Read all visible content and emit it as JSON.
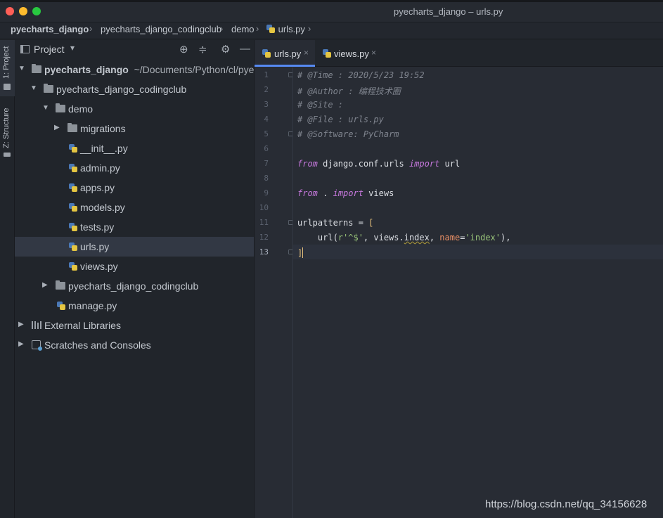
{
  "window": {
    "title": "pyecharts_django – urls.py",
    "controls": [
      "close",
      "minimize",
      "maximize"
    ]
  },
  "breadcrumb": [
    {
      "label": "pyecharts_django",
      "bold": true
    },
    {
      "label": "pyecharts_django_codingclub"
    },
    {
      "label": "demo"
    },
    {
      "label": "urls.py",
      "icon": "python-file-icon"
    }
  ],
  "side_strip": {
    "project_tab": "1: Project",
    "structure_tab": "Z: Structure"
  },
  "project_panel": {
    "title": "Project",
    "tree": [
      {
        "label": "pyecharts_django",
        "hint": "~/Documents/Python/cl/pyecharts_django",
        "type": "folder",
        "expanded": true,
        "bold": true
      },
      {
        "label": "pyecharts_django_codingclub",
        "type": "folder",
        "expanded": true
      },
      {
        "label": "demo",
        "type": "folder",
        "expanded": true
      },
      {
        "label": "migrations",
        "type": "folder",
        "expanded": false
      },
      {
        "label": "__init__.py",
        "type": "python"
      },
      {
        "label": "admin.py",
        "type": "python"
      },
      {
        "label": "apps.py",
        "type": "python"
      },
      {
        "label": "models.py",
        "type": "python"
      },
      {
        "label": "tests.py",
        "type": "python"
      },
      {
        "label": "urls.py",
        "type": "python",
        "selected": true
      },
      {
        "label": "views.py",
        "type": "python"
      },
      {
        "label": "pyecharts_django_codingclub",
        "type": "folder",
        "expanded": false
      },
      {
        "label": "manage.py",
        "type": "python"
      },
      {
        "label": "External Libraries",
        "type": "library",
        "expanded": false
      },
      {
        "label": "Scratches and Consoles",
        "type": "scratch",
        "expanded": false
      }
    ]
  },
  "editor": {
    "tabs": [
      {
        "label": "urls.py",
        "active": true,
        "close": "×"
      },
      {
        "label": "views.py",
        "active": false,
        "close": "×"
      }
    ],
    "line_numbers": [
      "1",
      "2",
      "3",
      "4",
      "5",
      "6",
      "7",
      "8",
      "9",
      "10",
      "11",
      "12",
      "13"
    ],
    "current_line": "13",
    "code": {
      "l1": "# @Time : 2020/5/23 19:52",
      "l2": "# @Author : 编程技术圈",
      "l3": "# @Site :",
      "l4": "# @File : urls.py",
      "l5": "# @Software: PyCharm",
      "l7_from": "from",
      "l7_module": " django.conf.urls ",
      "l7_import": "import",
      "l7_name": " url",
      "l9_from": "from",
      "l9_module": " . ",
      "l9_import": "import",
      "l9_name": " views",
      "l11_var": "urlpatterns = ",
      "l11_bracket": "[",
      "l12_call": "    url(",
      "l12_str1": "r'^$'",
      "l12_mid": ", views.",
      "l12_attr": "index",
      "l12_comma": ", ",
      "l12_param": "name",
      "l12_eq": "=",
      "l12_str2": "'index'",
      "l12_end": "),",
      "l13_bracket": "]"
    },
    "colors": {
      "comment": "#7f848e",
      "keyword": "#c678dd",
      "string": "#98c379",
      "param": "#e88e64",
      "bracket": "#e5c07b"
    }
  },
  "watermark": "https://blog.csdn.net/qq_34156628"
}
